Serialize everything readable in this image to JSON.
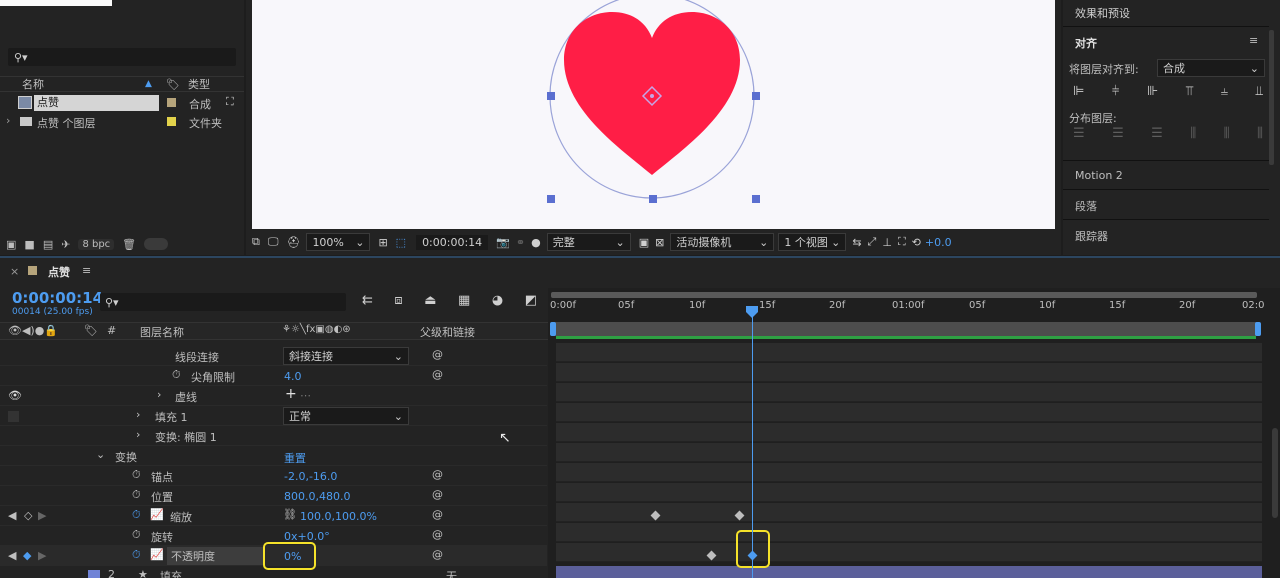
{
  "project": {
    "search_placeholder": "",
    "col_name": "名称",
    "col_type": "类型",
    "items": [
      {
        "name": "点赞",
        "type": "合成",
        "color": "#b6a47b"
      },
      {
        "name": "点赞 个图层",
        "type": "文件夹",
        "color": "#e2d24b"
      }
    ],
    "bpc": "8 bpc"
  },
  "viewer": {
    "zoom": "100%",
    "timecode": "0:00:00:14",
    "resolution": "完整",
    "camera": "活动摄像机",
    "views": "1 个视图",
    "exposure": "+0.0",
    "heart_color": "#ff1e46"
  },
  "right_panel": {
    "effects_title": "效果和预设",
    "align_title": "对齐",
    "align_to_label": "将图层对齐到:",
    "align_to_value": "合成",
    "distribute_label": "分布图层:",
    "motion2": "Motion 2",
    "paragraph": "段落",
    "tracker": "跟踪器"
  },
  "timeline": {
    "comp_tab": "点赞",
    "timecode": "0:00:00:14",
    "frame_info": "00014 (25.00 fps)",
    "col_layer_name": "图层名称",
    "col_parent": "父级和链接",
    "ruler_labels": [
      "0:00f",
      "05f",
      "10f",
      "15f",
      "20f",
      "01:00f",
      "05f",
      "10f",
      "15f",
      "20f",
      "02:0"
    ],
    "properties": [
      {
        "name": "线段连接",
        "value": "斜接连接"
      },
      {
        "name": "尖角限制",
        "value": "4.0"
      },
      {
        "name": "虚线",
        "value": "+"
      },
      {
        "name": "填充 1",
        "value": "正常"
      },
      {
        "name": "变换: 椭圆 1",
        "value": ""
      },
      {
        "name": "变换",
        "value": "重置"
      },
      {
        "name": "锚点",
        "value": "-2.0,-16.0"
      },
      {
        "name": "位置",
        "value": "800.0,480.0"
      },
      {
        "name": "缩放",
        "value": "100.0,100.0%"
      },
      {
        "name": "旋转",
        "value": "0x+0.0°"
      },
      {
        "name": "不透明度",
        "value": "0%"
      }
    ],
    "bottom_layer_num": "2",
    "bottom_layer_name": "填充",
    "bottom_mode": "无"
  }
}
